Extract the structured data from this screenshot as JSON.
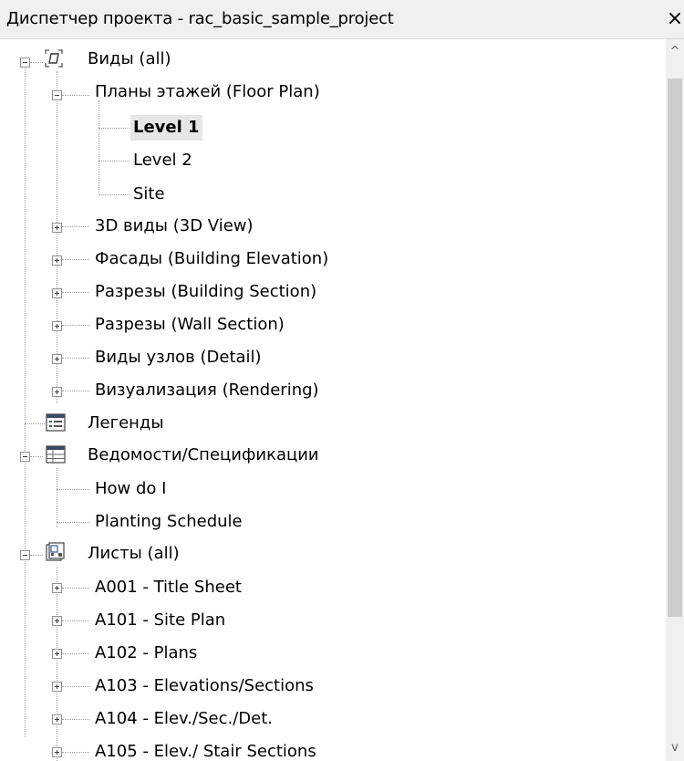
{
  "window": {
    "title": "Диспетчер проекта - rac_basic_sample_project",
    "close_label": "×"
  },
  "tree": {
    "views": {
      "label": "Виды (all)",
      "floor_plans": {
        "label": "Планы этажей (Floor Plan)",
        "items": [
          "Level 1",
          "Level 2",
          "Site"
        ],
        "selected": "Level 1"
      },
      "groups": [
        "3D виды (3D View)",
        "Фасады (Building Elevation)",
        "Разрезы (Building Section)",
        "Разрезы (Wall Section)",
        "Виды узлов (Detail)",
        "Визуализация (Rendering)"
      ]
    },
    "legends": {
      "label": "Легенды"
    },
    "schedules": {
      "label": "Ведомости/Спецификации",
      "items": [
        "How do I",
        "Planting Schedule"
      ]
    },
    "sheets": {
      "label": "Листы (all)",
      "items": [
        "A001 - Title Sheet",
        "A101 - Site Plan",
        "A102 - Plans",
        "A103 - Elevations/Sections",
        "A104 - Elev./Sec./Det.",
        "A105 - Elev./ Stair Sections"
      ]
    }
  },
  "scrollbar": {
    "up_arrow": "^",
    "down_arrow": "v"
  }
}
